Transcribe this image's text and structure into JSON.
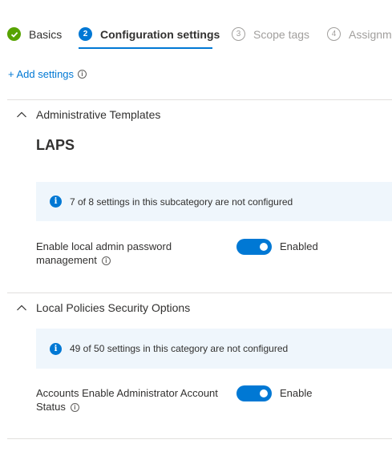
{
  "wizard": {
    "steps": [
      {
        "number": "",
        "label": "Basics",
        "state": "done"
      },
      {
        "number": "2",
        "label": "Configuration settings",
        "state": "active"
      },
      {
        "number": "3",
        "label": "Scope tags",
        "state": "pending"
      },
      {
        "number": "4",
        "label": "Assignme",
        "state": "pending"
      }
    ]
  },
  "add_settings": {
    "label": "+ Add settings"
  },
  "sections": [
    {
      "title": "Administrative Templates",
      "subcategory": "LAPS",
      "info": "7 of 8 settings in this subcategory are not configured",
      "setting": {
        "label": "Enable local admin password management",
        "value": "Enabled",
        "on": true
      }
    },
    {
      "title": "Local Policies Security Options",
      "info": "49 of 50 settings in this category are not configured",
      "setting": {
        "label": "Accounts Enable Administrator Account Status",
        "value": "Enable",
        "on": true
      }
    }
  ],
  "colors": {
    "accent": "#0078d4",
    "success": "#57a300",
    "info_bg": "#eff6fc"
  }
}
